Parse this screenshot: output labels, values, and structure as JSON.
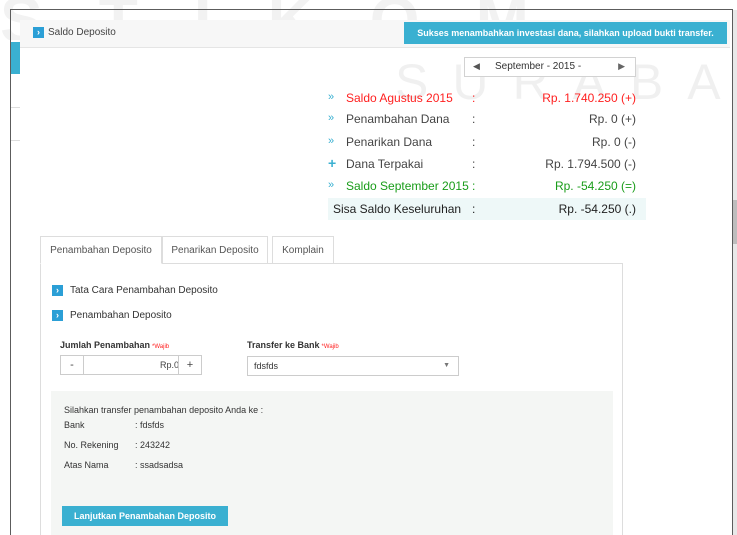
{
  "header": {
    "title": "Saldo Deposito",
    "success_message": "Sukses menambahkan investasi dana, silahkan upload bukti transfer."
  },
  "month_nav": {
    "month": "September",
    "year": "2015",
    "label": "September -  2015 -"
  },
  "summary": {
    "rows": [
      {
        "label": "Saldo Agustus 2015",
        "colon": ":",
        "value": "Rp. 1.740.250 (+)"
      },
      {
        "label": "Penambahan Dana",
        "colon": ":",
        "value": "Rp. 0 (+)"
      },
      {
        "label": "Penarikan Dana",
        "colon": ":",
        "value": "Rp. 0 (-)"
      },
      {
        "label": "Dana Terpakai",
        "colon": ":",
        "value": "Rp. 1.794.500 (-)"
      },
      {
        "label": "Saldo September 2015",
        "colon": ":",
        "value": "Rp. -54.250 (=)"
      },
      {
        "label": "Sisa Saldo Keseluruhan",
        "colon": ":",
        "value": "Rp. -54.250 (.)"
      }
    ]
  },
  "tabs": [
    {
      "label": "Penambahan Deposito",
      "active": true
    },
    {
      "label": "Penarikan Deposito",
      "active": false
    },
    {
      "label": "Komplain",
      "active": false
    }
  ],
  "sections": {
    "guide": "Tata Cara Penambahan Deposito",
    "add": "Penambahan Deposito"
  },
  "form": {
    "amount_label": "Jumlah Penambahan",
    "required_mark": "*Wajib",
    "minus": "-",
    "amount_value": "Rp.0",
    "plus": "+",
    "bank_label": "Transfer ke Bank",
    "bank_selected": "fdsfds"
  },
  "transfer_info": {
    "intro": "Silahkan transfer penambahan deposito Anda ke :",
    "rows": [
      {
        "key": "Bank",
        "value": ": fdsfds"
      },
      {
        "key": "No. Rekening",
        "value": ": 243242"
      },
      {
        "key": "Atas Nama",
        "value": ": ssadsadsa"
      }
    ]
  },
  "submit_label": "Lanjutkan Penambahan Deposito",
  "watermark": {
    "top": "STIKOM",
    "middle": "SURABAYA"
  },
  "icons": {
    "chevron_right": "›",
    "double_chevron": "»",
    "plus": "+",
    "prev": "◀",
    "next": "▶",
    "caret_down": "▼"
  },
  "colors": {
    "accent": "#3ab0d1",
    "button_blue": "#2b9fd6",
    "red": "#ff2020",
    "green": "#199c19"
  }
}
